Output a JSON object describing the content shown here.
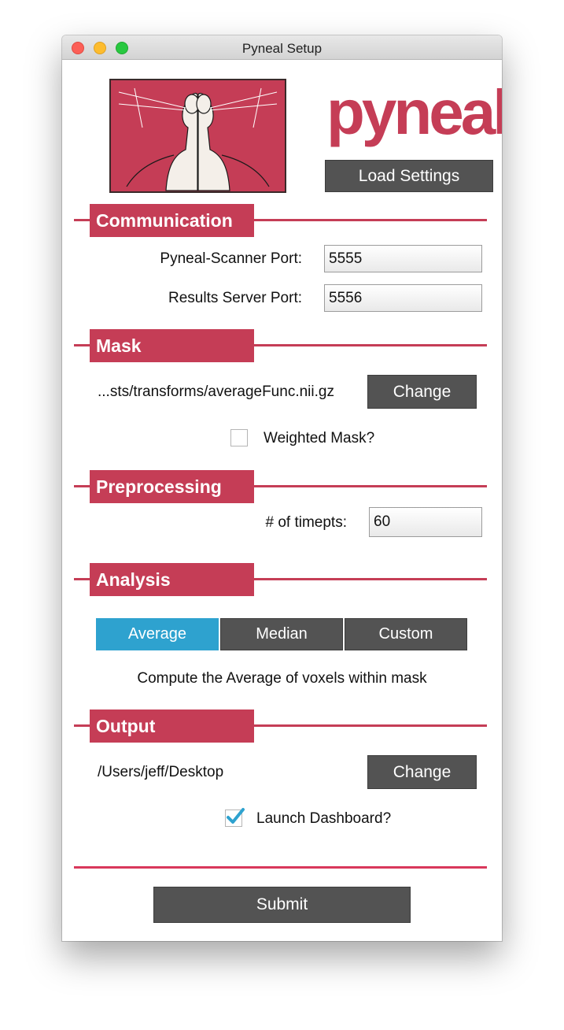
{
  "window": {
    "title": "Pyneal Setup"
  },
  "header": {
    "logo_text": "pyneal",
    "load_settings_label": "Load Settings"
  },
  "communication": {
    "heading": "Communication",
    "scanner_port_label": "Pyneal-Scanner Port:",
    "scanner_port_value": "5555",
    "results_port_label": "Results Server Port:",
    "results_port_value": "5556"
  },
  "mask": {
    "heading": "Mask",
    "path": "...sts/transforms/averageFunc.nii.gz",
    "change_label": "Change",
    "weighted_label": "Weighted Mask?",
    "weighted_checked": false
  },
  "preprocessing": {
    "heading": "Preprocessing",
    "timepts_label": "# of timepts:",
    "timepts_value": "60"
  },
  "analysis": {
    "heading": "Analysis",
    "options": [
      "Average",
      "Median",
      "Custom"
    ],
    "selected": "Average",
    "description": "Compute the Average of voxels within mask"
  },
  "output": {
    "heading": "Output",
    "path": "/Users/jeff/Desktop",
    "change_label": "Change",
    "dashboard_label": "Launch Dashboard?",
    "dashboard_checked": true
  },
  "footer": {
    "submit_label": "Submit"
  },
  "colors": {
    "accent": "#c53d56",
    "button": "#535353",
    "selected": "#2ea2cf"
  }
}
